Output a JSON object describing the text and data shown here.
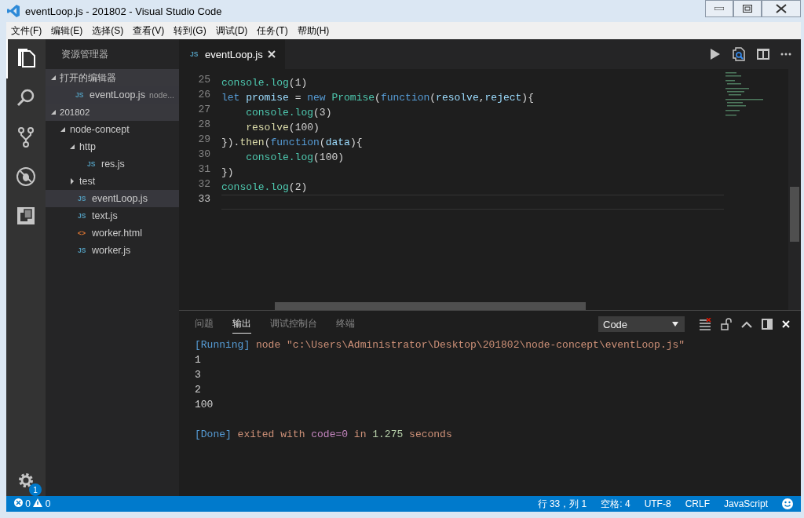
{
  "window": {
    "title": "eventLoop.js - 201802 - Visual Studio Code"
  },
  "menu": [
    "文件(F)",
    "编辑(E)",
    "选择(S)",
    "查看(V)",
    "转到(G)",
    "调试(D)",
    "任务(T)",
    "帮助(H)"
  ],
  "activity_bar": {
    "items": [
      {
        "kind": "files",
        "selected": true
      },
      {
        "kind": "search",
        "selected": false
      },
      {
        "kind": "git",
        "selected": false
      },
      {
        "kind": "debug",
        "selected": false
      },
      {
        "kind": "extensions",
        "selected": false
      }
    ],
    "settings_badge": "1"
  },
  "sidebar": {
    "title": "资源管理器",
    "sections": [
      {
        "label": "打开的编辑器",
        "expanded": true,
        "items": [
          {
            "kind": "js",
            "icon": "JS",
            "label": "eventLoop.js",
            "description": "node...",
            "selected": true
          }
        ]
      },
      {
        "label": "201802",
        "expanded": true,
        "items": [
          {
            "kind": "folder",
            "label": "node-concept",
            "expanded": true,
            "selected": false,
            "children": [
              {
                "kind": "folder",
                "label": "http",
                "expanded": true,
                "selected": false,
                "children": [
                  {
                    "kind": "js",
                    "icon": "JS",
                    "label": "res.js",
                    "selected": false
                  }
                ]
              },
              {
                "kind": "folder",
                "label": "test",
                "expanded": false,
                "selected": false
              },
              {
                "kind": "js",
                "icon": "JS",
                "label": "eventLoop.js",
                "selected": true
              },
              {
                "kind": "js",
                "icon": "JS",
                "label": "text.js",
                "selected": false
              },
              {
                "kind": "html",
                "icon": "<>",
                "label": "worker.html",
                "selected": false
              },
              {
                "kind": "js",
                "icon": "JS",
                "label": "worker.js",
                "selected": false
              }
            ]
          }
        ]
      }
    ]
  },
  "editor": {
    "tabs": [
      {
        "kind": "js",
        "icon": "JS",
        "label": "eventLoop.js",
        "selected": true
      }
    ],
    "lines": [
      {
        "number": "25",
        "current": false,
        "tokens": [
          {
            "t": "console.log",
            "kind": "obj"
          },
          {
            "t": "(1)",
            "kind": "plain"
          }
        ]
      },
      {
        "number": "26",
        "current": false,
        "tokens": [
          {
            "t": "let ",
            "kind": "kw"
          },
          {
            "t": "promise",
            "kind": "var"
          },
          {
            "t": " = ",
            "kind": "plain"
          },
          {
            "t": "new ",
            "kind": "kw"
          },
          {
            "t": "Promise",
            "kind": "obj"
          },
          {
            "t": "(",
            "kind": "plain"
          },
          {
            "t": "function",
            "kind": "kw"
          },
          {
            "t": "(",
            "kind": "plain"
          },
          {
            "t": "resolve",
            "kind": "var"
          },
          {
            "t": ",",
            "kind": "plain"
          },
          {
            "t": "reject",
            "kind": "var"
          },
          {
            "t": "){",
            "kind": "plain"
          }
        ]
      },
      {
        "number": "27",
        "current": false,
        "tokens": [
          {
            "t": "    console.log",
            "kind": "obj"
          },
          {
            "t": "(3)",
            "kind": "plain"
          }
        ]
      },
      {
        "number": "28",
        "current": false,
        "tokens": [
          {
            "t": "    resolve",
            "kind": "fn"
          },
          {
            "t": "(100)",
            "kind": "plain"
          }
        ]
      },
      {
        "number": "29",
        "current": false,
        "tokens": [
          {
            "t": "}).",
            "kind": "plain"
          },
          {
            "t": "then",
            "kind": "fn"
          },
          {
            "t": "(",
            "kind": "plain"
          },
          {
            "t": "function",
            "kind": "kw"
          },
          {
            "t": "(",
            "kind": "plain"
          },
          {
            "t": "data",
            "kind": "var"
          },
          {
            "t": "){",
            "kind": "plain"
          }
        ]
      },
      {
        "number": "30",
        "current": false,
        "tokens": [
          {
            "t": "    console.log",
            "kind": "obj"
          },
          {
            "t": "(100)",
            "kind": "plain"
          }
        ]
      },
      {
        "number": "31",
        "current": false,
        "tokens": [
          {
            "t": "})",
            "kind": "plain"
          }
        ]
      },
      {
        "number": "32",
        "current": false,
        "tokens": [
          {
            "t": "console.log",
            "kind": "obj"
          },
          {
            "t": "(2)",
            "kind": "plain"
          }
        ]
      },
      {
        "number": "33",
        "current": true
      }
    ]
  },
  "panel": {
    "tabs": [
      {
        "label": "问题",
        "selected": false
      },
      {
        "label": "输出",
        "selected": true
      },
      {
        "label": "调试控制台",
        "selected": false
      },
      {
        "label": "终端",
        "selected": false
      }
    ],
    "channel": "Code",
    "output": [
      [
        {
          "t": "[Running]",
          "kind": "tag"
        },
        {
          "t": " node \"c:\\Users\\Administrator\\Desktop\\201802\\node-concept\\eventLoop.js\"",
          "kind": "str"
        }
      ],
      [
        {
          "t": "1",
          "kind": "plain"
        }
      ],
      [
        {
          "t": "3",
          "kind": "plain"
        }
      ],
      [
        {
          "t": "2",
          "kind": "plain"
        }
      ],
      [
        {
          "t": "100",
          "kind": "plain"
        }
      ],
      [
        {
          "t": "[Done]",
          "kind": "tag"
        },
        {
          "t": " exited with ",
          "kind": "str"
        },
        {
          "t": "code=0",
          "kind": "purple"
        },
        {
          "t": " in ",
          "kind": "str"
        },
        {
          "t": "1.275",
          "kind": "num"
        },
        {
          "t": " seconds",
          "kind": "str"
        }
      ]
    ]
  },
  "status_bar": {
    "errors": "0",
    "warnings": "0",
    "items": [
      "行 33，列 1",
      "空格: 4",
      "UTF-8",
      "CRLF",
      "JavaScript"
    ]
  }
}
